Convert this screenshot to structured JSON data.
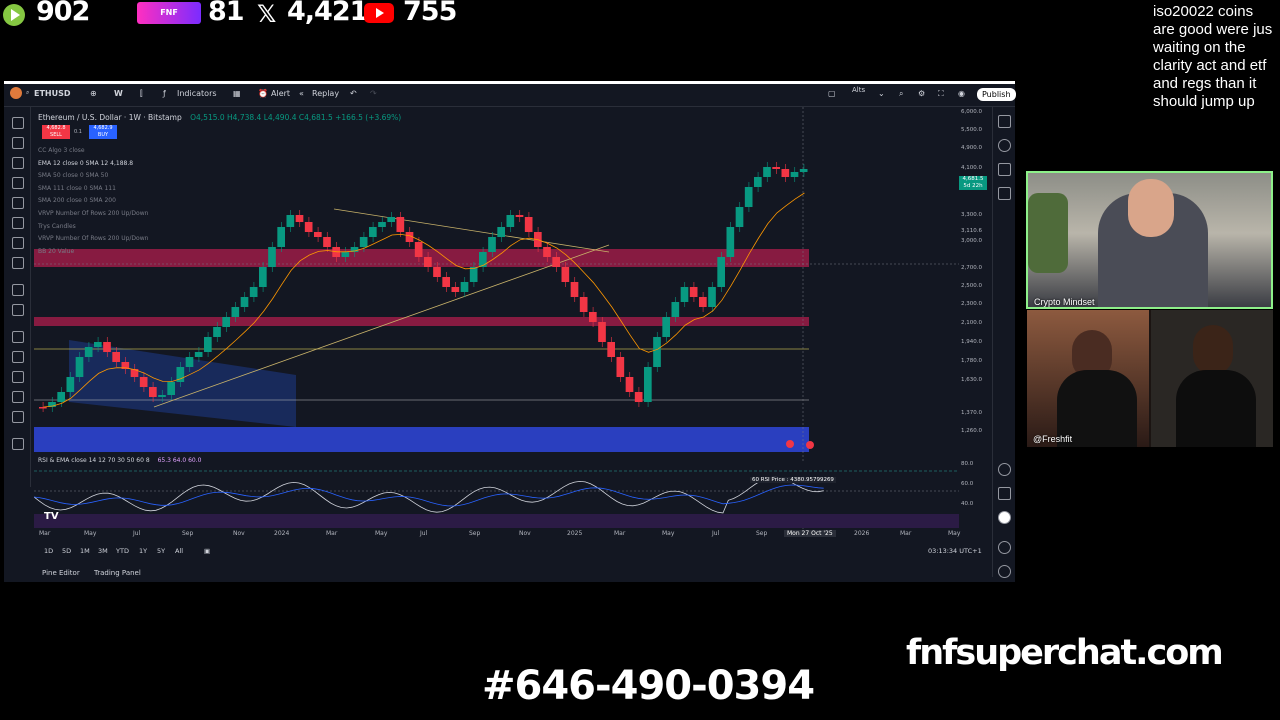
{
  "overlay": {
    "rumble_count": "902",
    "kick_badge_text": "FNF",
    "kick_count": "81",
    "x_count": "4,421",
    "youtube_count": "755",
    "chat_message": "iso20022 coins\nare good were jus\nwaiting on the\nclarity act and etf\nand regs than it\nshould jump up",
    "phone": "#646-490-0394",
    "site": "fnfsuperchat.com",
    "cam1_name": "Crypto Mindset",
    "cam2_name": "@Freshfit"
  },
  "toolbar": {
    "symbol": "ETHUSD",
    "interval": "W",
    "indicators": "Indicators",
    "alert": "Alert",
    "replay": "Replay",
    "alts": "Alts",
    "publish": "Publish",
    "currency": "USD"
  },
  "legend": {
    "title": "Ethereum / U.S. Dollar · 1W · Bitstamp",
    "ohlc": "O4,515.0 H4,738.4 L4,490.4 C4,681.5 +166.5 (+3.69%)",
    "sell_price": "4,682.8",
    "sell_label": "SELL",
    "spread": "0.1",
    "buy_price": "4,682.9",
    "buy_label": "BUY",
    "indicators": [
      "CC Algo 3 close",
      "EMA 12 close 0 SMA 12   4,188.8",
      "SMA 50 close 0 SMA 50",
      "SMA 111 close 0 SMA 111",
      "SMA 200 close 0 SMA 200",
      "VRVP Number Of Rows 200 Up/Down",
      "Trys Candles",
      "VRVP Number Of Rows 200 Up/Down",
      "BB 20 Value"
    ]
  },
  "price_axis": [
    "6,000.0",
    "5,500.0",
    "4,900.0",
    "4,100.0",
    "3,700.0",
    "3,300.0",
    "3,110.6",
    "3,000.0",
    "2,700.0",
    "2,500.0",
    "2,300.0",
    "2,100.0",
    "1,940.0",
    "1,780.0",
    "1,630.0",
    "1,370.0",
    "1,260.0"
  ],
  "last_price_label": "4,681.5",
  "last_price_sub": "5d 22h",
  "rsi": {
    "label": "RSI & EMA close 14 12 70 30 50 60 8",
    "values": "65.3  64.0  60.0",
    "price_note": "60 RSI Price : 4380.95799269",
    "axis": [
      "80.0",
      "60.0",
      "40.0"
    ]
  },
  "time_axis": [
    "Mar",
    "May",
    "Jul",
    "Sep",
    "Nov",
    "2024",
    "Mar",
    "May",
    "Jul",
    "Sep",
    "Nov",
    "2025",
    "Mar",
    "May",
    "Jul",
    "Sep",
    "Mon 27 Oct '25",
    "2026",
    "Mar",
    "May"
  ],
  "ranges": [
    "1D",
    "5D",
    "1M",
    "3M",
    "YTD",
    "1Y",
    "5Y",
    "All"
  ],
  "clock": "03:13:34 UTC+1",
  "bottom_tabs": [
    "Pine Editor",
    "Trading Panel"
  ],
  "colors": {
    "bull": "#089981",
    "bear": "#f23645",
    "accent": "#2962ff",
    "ema": "#ff9800",
    "zone_red": "#c2185b",
    "zone_blue": "#2a3fbf",
    "cam_border": "#8ef08a"
  }
}
